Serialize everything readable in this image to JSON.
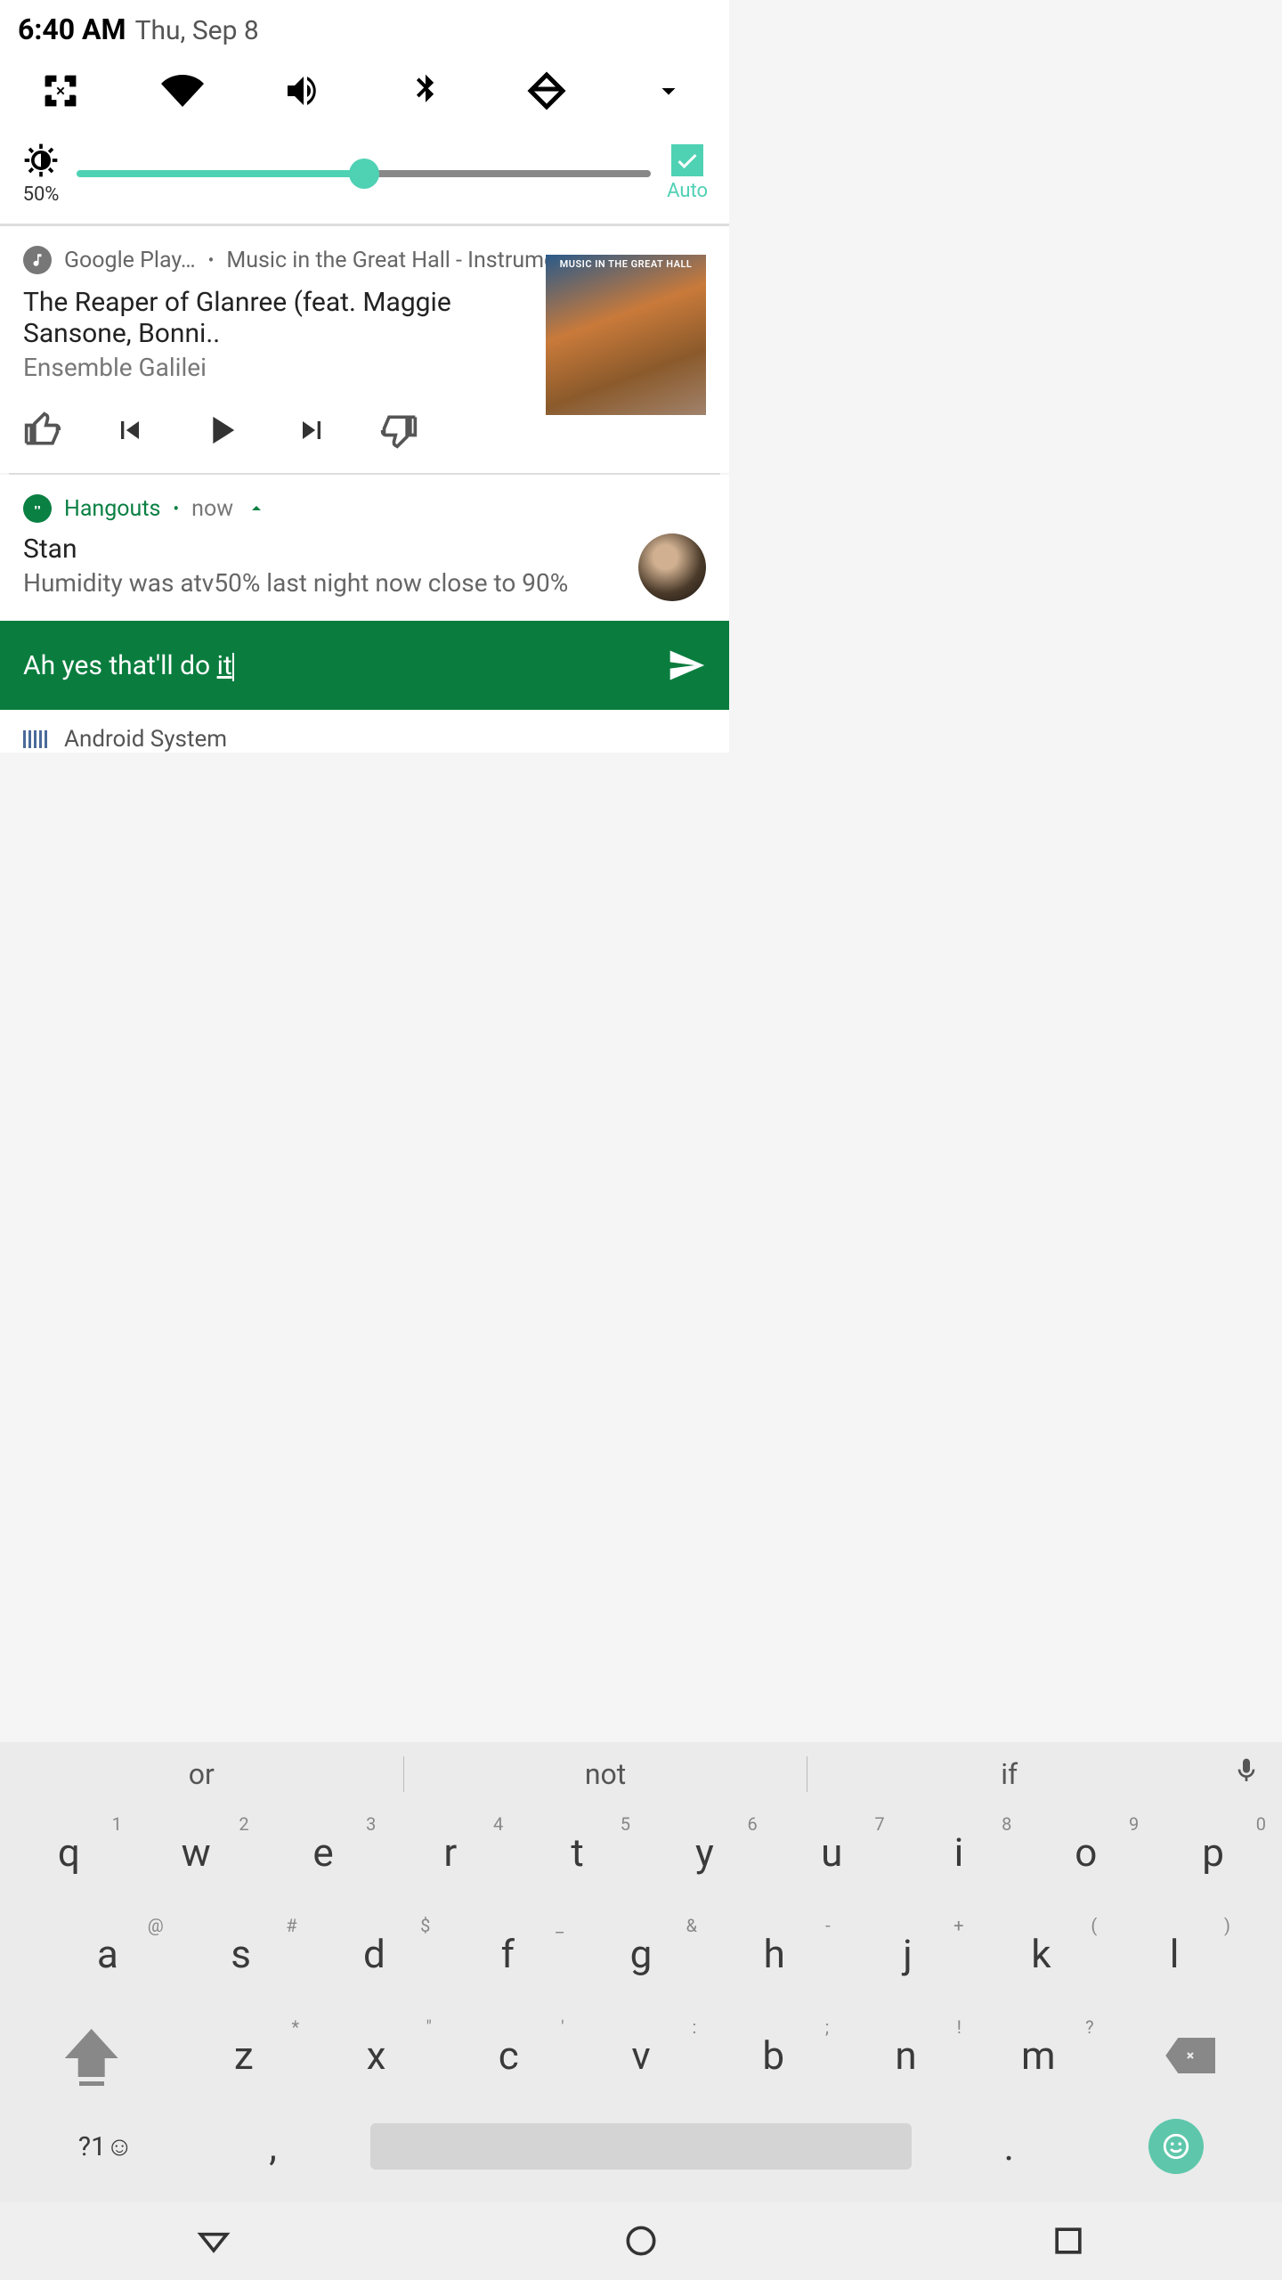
{
  "status": {
    "time": "6:40 AM",
    "date": "Thu, Sep 8"
  },
  "brightness": {
    "percent_label": "50%",
    "auto_label": "Auto"
  },
  "music": {
    "app_label": "Google Play…",
    "context": "Music in the Great Hall - Instrumen…",
    "track_title": "The Reaper of Glanree (feat. Maggie Sansone, Bonni..",
    "artist": "Ensemble Galilei",
    "album_overlay": "MUSIC IN THE GREAT HALL"
  },
  "hangouts": {
    "app_label": "Hangouts",
    "time_ago": "now",
    "sender": "Stan",
    "message": "Humidity was atv50% last night now close to 90%",
    "reply_prefix": "Ah yes that'll do ",
    "reply_cursor_word": "it"
  },
  "peek": {
    "label": "Android System"
  },
  "suggestions": {
    "s1": "or",
    "s2": "not",
    "s3": "if"
  },
  "keys": {
    "row1": [
      {
        "c": "q",
        "h": "1"
      },
      {
        "c": "w",
        "h": "2"
      },
      {
        "c": "e",
        "h": "3"
      },
      {
        "c": "r",
        "h": "4"
      },
      {
        "c": "t",
        "h": "5"
      },
      {
        "c": "y",
        "h": "6"
      },
      {
        "c": "u",
        "h": "7"
      },
      {
        "c": "i",
        "h": "8"
      },
      {
        "c": "o",
        "h": "9"
      },
      {
        "c": "p",
        "h": "0"
      }
    ],
    "row2": [
      {
        "c": "a",
        "h": "@"
      },
      {
        "c": "s",
        "h": "#"
      },
      {
        "c": "d",
        "h": "$"
      },
      {
        "c": "f",
        "h": "_"
      },
      {
        "c": "g",
        "h": "&"
      },
      {
        "c": "h",
        "h": "-"
      },
      {
        "c": "j",
        "h": "+"
      },
      {
        "c": "k",
        "h": "("
      },
      {
        "c": "l",
        "h": ")"
      }
    ],
    "row3": [
      {
        "c": "z",
        "h": "*"
      },
      {
        "c": "x",
        "h": "\""
      },
      {
        "c": "c",
        "h": "'"
      },
      {
        "c": "v",
        "h": ":"
      },
      {
        "c": "b",
        "h": ";"
      },
      {
        "c": "n",
        "h": "!"
      },
      {
        "c": "m",
        "h": "?"
      }
    ],
    "mode": "?1☺",
    "comma": ",",
    "period": "."
  }
}
